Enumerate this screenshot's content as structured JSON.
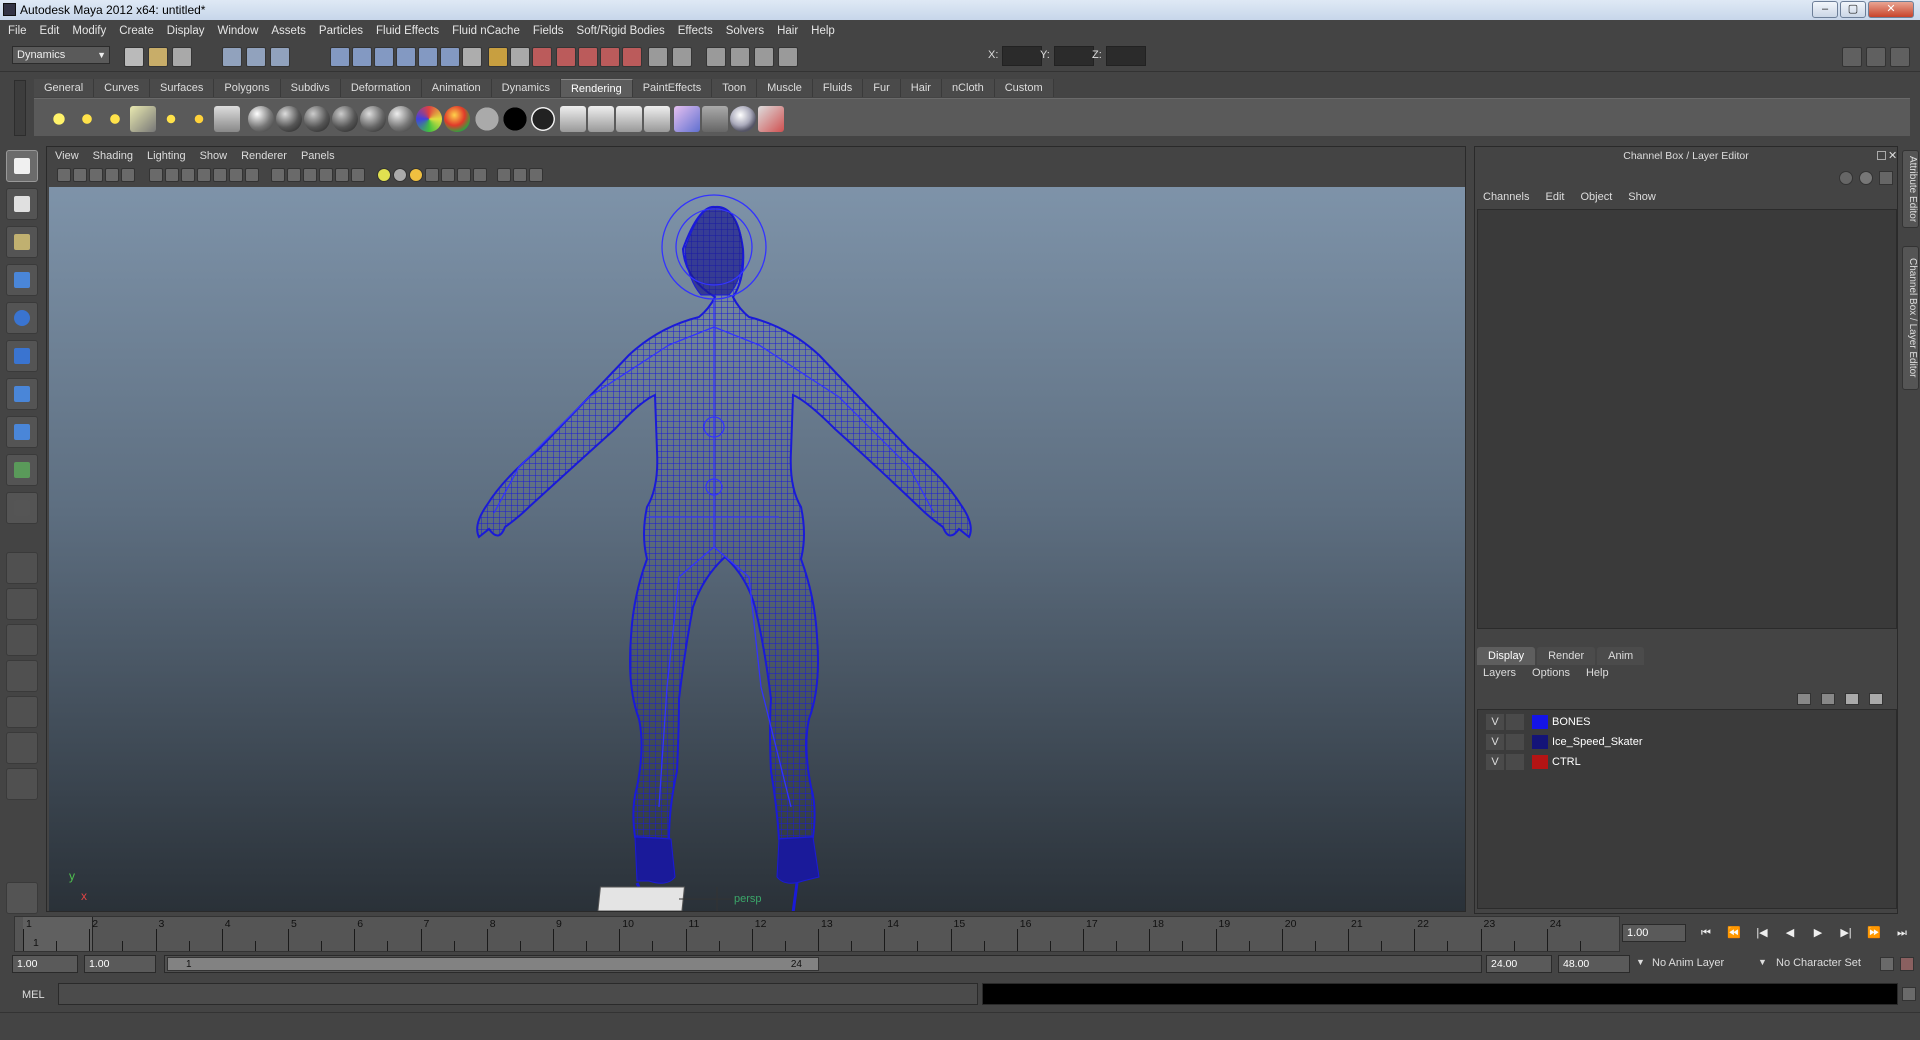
{
  "window": {
    "title": "Autodesk Maya 2012 x64: untitled*",
    "controls": [
      "–",
      "▢",
      "✕"
    ]
  },
  "menubar": [
    "File",
    "Edit",
    "Modify",
    "Create",
    "Display",
    "Window",
    "Assets",
    "Particles",
    "Fluid Effects",
    "Fluid nCache",
    "Fields",
    "Soft/Rigid Bodies",
    "Effects",
    "Solvers",
    "Hair",
    "Help"
  ],
  "statusline": {
    "mode": "Dynamics",
    "x_label": "X:",
    "y_label": "Y:",
    "z_label": "Z:"
  },
  "shelf": {
    "tabs": [
      "General",
      "Curves",
      "Surfaces",
      "Polygons",
      "Subdivs",
      "Deformation",
      "Animation",
      "Dynamics",
      "Rendering",
      "PaintEffects",
      "Toon",
      "Muscle",
      "Fluids",
      "Fur",
      "Hair",
      "nCloth",
      "Custom"
    ],
    "active_tab": "Rendering"
  },
  "viewport": {
    "menu": [
      "View",
      "Shading",
      "Lighting",
      "Show",
      "Renderer",
      "Panels"
    ],
    "camera_label": "persp",
    "axis_y": "y",
    "axis_x": "x",
    "colors": {
      "wire": "#1a1ad8",
      "joint": "#3333ff"
    }
  },
  "channel_box": {
    "title": "Channel Box / Layer Editor",
    "menu": [
      "Channels",
      "Edit",
      "Object",
      "Show"
    ]
  },
  "layer_editor": {
    "tabs": [
      "Display",
      "Render",
      "Anim"
    ],
    "active_tab": "Display",
    "menu": [
      "Layers",
      "Options",
      "Help"
    ],
    "layers": [
      {
        "visible": "V",
        "name": "BONES",
        "color": "#1414e6"
      },
      {
        "visible": "V",
        "name": "Ice_Speed_Skater",
        "color": "#141478"
      },
      {
        "visible": "V",
        "name": "CTRL",
        "color": "#b41414"
      }
    ]
  },
  "side_tabs": [
    "Attribute Editor",
    "Channel Box / Layer Editor"
  ],
  "time_slider": {
    "frames": [
      "1",
      "2",
      "3",
      "4",
      "5",
      "6",
      "7",
      "8",
      "9",
      "10",
      "11",
      "12",
      "13",
      "14",
      "15",
      "16",
      "17",
      "18",
      "19",
      "20",
      "21",
      "22",
      "23",
      "24"
    ],
    "current_marker": "1",
    "current_frame": "1.00",
    "playback_buttons": [
      "⏮",
      "⏪",
      "|◀",
      "◀",
      "▶",
      "▶|",
      "⏩",
      "⏭"
    ]
  },
  "range_slider": {
    "start_time": "1.00",
    "playback_start": "1.00",
    "thumb_start": "1",
    "thumb_end": "24",
    "playback_end": "24.00",
    "end_time": "48.00",
    "anim_layer": "No Anim Layer",
    "character_set": "No Character Set"
  },
  "command_line": {
    "label": "MEL"
  }
}
